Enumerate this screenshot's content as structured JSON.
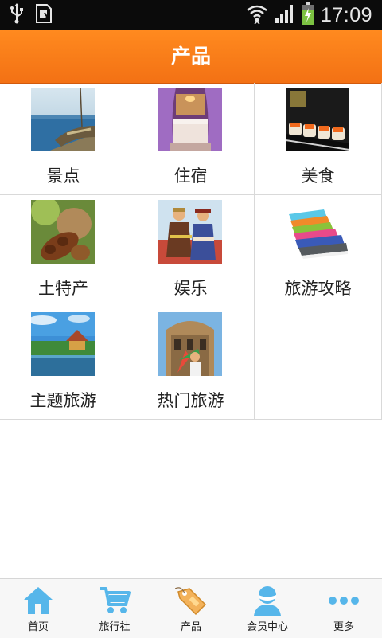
{
  "status_bar": {
    "time": "17:09",
    "icons": [
      "usb-icon",
      "sim-card-icon",
      "wifi-icon",
      "signal-icon",
      "battery-charging-icon"
    ]
  },
  "header": {
    "title": "产品"
  },
  "categories": [
    {
      "label": "景点",
      "icon": "lake-boat-image"
    },
    {
      "label": "住宿",
      "icon": "hotel-room-image"
    },
    {
      "label": "美食",
      "icon": "sushi-image"
    },
    {
      "label": "土特产",
      "icon": "tamarind-image"
    },
    {
      "label": "娱乐",
      "icon": "folk-dancers-image"
    },
    {
      "label": "旅游攻略",
      "icon": "books-image"
    },
    {
      "label": "主题旅游",
      "icon": "lakeside-pagoda-image"
    },
    {
      "label": "热门旅游",
      "icon": "tourist-building-image"
    }
  ],
  "bottom_nav": [
    {
      "label": "首页",
      "icon": "home-icon"
    },
    {
      "label": "旅行社",
      "icon": "shopping-cart-icon"
    },
    {
      "label": "产品",
      "icon": "price-tag-icon",
      "active": true
    },
    {
      "label": "会员中心",
      "icon": "user-icon"
    },
    {
      "label": "更多",
      "icon": "more-dots-icon"
    }
  ],
  "colors": {
    "header_orange": "#f57a18",
    "nav_icon_blue": "#56b6ea",
    "active_tag": "#f3b25a"
  }
}
